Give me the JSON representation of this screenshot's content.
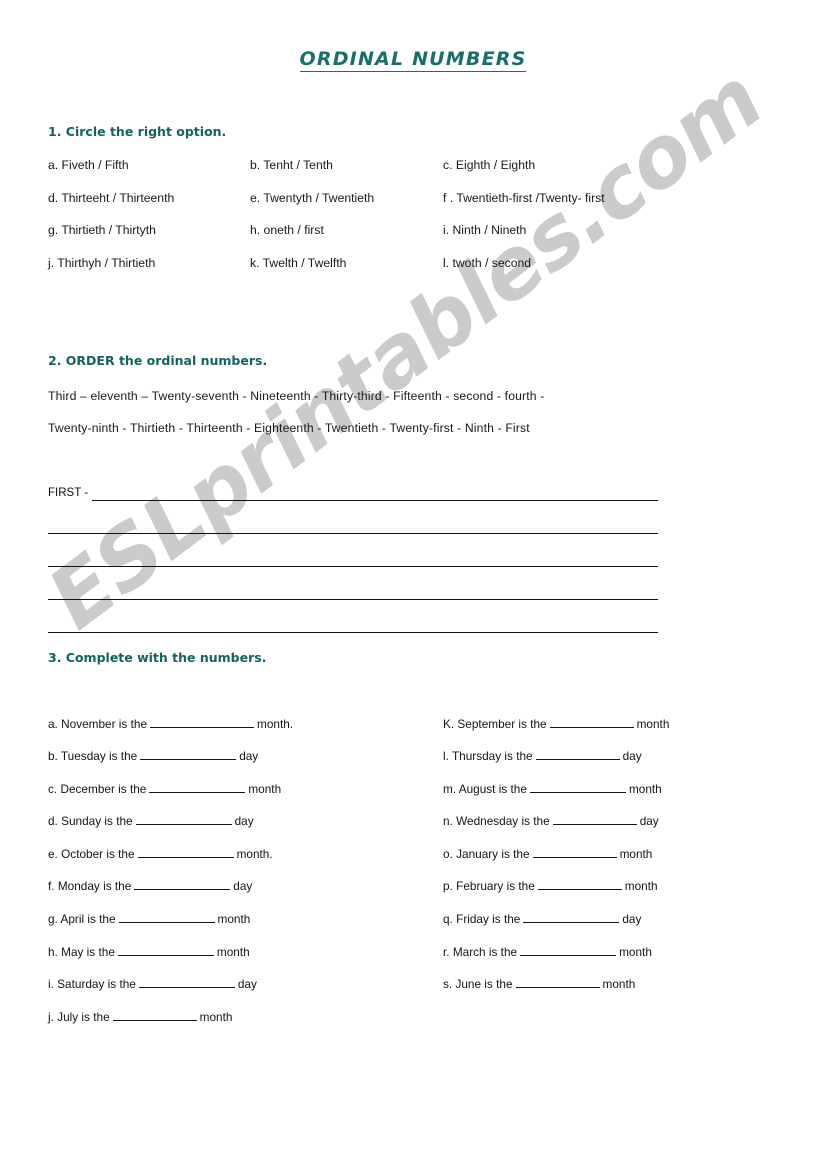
{
  "page": {
    "title": "ORDINAL NUMBERS",
    "accent_color": "#18706b",
    "heading_color": "#14635f",
    "text_color": "#1a1a1a",
    "background_color": "#ffffff",
    "watermark": "ESLprintables.com",
    "watermark_color": "#cbcbcb"
  },
  "exercise1": {
    "heading": "1. Circle the right option.",
    "items": [
      {
        "label": "a. Fiveth / Fifth"
      },
      {
        "label": "b. Tenht / Tenth"
      },
      {
        "label": "c. Eighth / Eighth"
      },
      {
        "label": "d. Thirteeht / Thirteenth"
      },
      {
        "label": "e. Twentyth / Twentieth"
      },
      {
        "label": "f . Twentieth-first /Twenty- first"
      },
      {
        "label": "g. Thirtieth / Thirtyth"
      },
      {
        "label": "h. oneth / first"
      },
      {
        "label": "i. Ninth / Nineth"
      },
      {
        "label": "j. Thirthyh / Thirtieth"
      },
      {
        "label": "k. Twelth / Twelfth"
      },
      {
        "label": "l. twoth / second"
      }
    ]
  },
  "exercise2": {
    "heading": "2. ORDER the ordinal numbers.",
    "word_line_1": "Third  –  eleventh  –  Twenty-seventh  - Nineteenth  - Thirty-third   -  Fifteenth  -  second  -  fourth  -",
    "word_line_2": "Twenty-ninth  -  Thirtieth  -  Thirteenth  -  Eighteenth  -  Twentieth  -  Twenty-first  -  Ninth  -  First",
    "words": [
      "Third",
      "eleventh",
      "Twenty-seventh",
      "Nineteenth",
      "Thirty-third",
      "Fifteenth",
      "second",
      "fourth",
      "Twenty-ninth",
      "Thirtieth",
      "Thirteenth",
      "Eighteenth",
      "Twentieth",
      "Twenty-first",
      "Ninth",
      "First"
    ],
    "answer_prefix": "FIRST -",
    "answer_line_count": 5
  },
  "exercise3": {
    "heading": "3. Complete with the numbers.",
    "left_items": [
      {
        "before": "a. November is the",
        "after": "month.",
        "blank": "b-xl"
      },
      {
        "before": "b. Tuesday is the",
        "after": "day",
        "blank": "b-l"
      },
      {
        "before": "c. December is the",
        "after": "month",
        "blank": "b-l"
      },
      {
        "before": "d. Sunday is the",
        "after": "day",
        "blank": "b-l"
      },
      {
        "before": "e. October is the",
        "after": "month.",
        "blank": "b-l"
      },
      {
        "before": "f. Monday is the",
        "after": "day",
        "blank": "b-l"
      },
      {
        "before": "g. April is the",
        "after": "month",
        "blank": "b-l"
      },
      {
        "before": "h. May is the",
        "after": "month",
        "blank": "b-l"
      },
      {
        "before": "i. Saturday is the",
        "after": "day",
        "blank": "b-l"
      },
      {
        "before": "j. July is the",
        "after": "month",
        "blank": "b-m"
      }
    ],
    "right_items": [
      {
        "before": "K. September is the",
        "after": "month",
        "blank": "b-m"
      },
      {
        "before": "l. Thursday is the",
        "after": "day",
        "blank": "b-m"
      },
      {
        "before": "m. August is the",
        "after": "month",
        "blank": "b-l"
      },
      {
        "before": "n. Wednesday is the",
        "after": "day",
        "blank": "b-m"
      },
      {
        "before": "o. January is the",
        "after": "month",
        "blank": "b-m"
      },
      {
        "before": "p. February is the",
        "after": "month",
        "blank": "b-m"
      },
      {
        "before": "q. Friday is the",
        "after": "day",
        "blank": "b-l"
      },
      {
        "before": "r. March is the",
        "after": "month",
        "blank": "b-l"
      },
      {
        "before": "s. June is the",
        "after": "month",
        "blank": "b-m"
      }
    ]
  }
}
